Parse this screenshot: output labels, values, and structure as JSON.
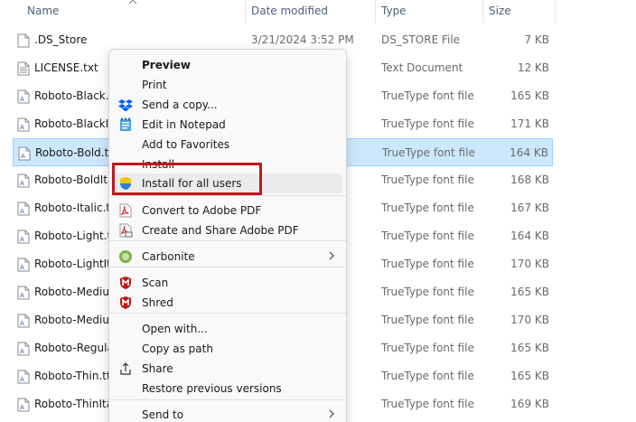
{
  "header": {
    "columns": [
      {
        "label": "Name"
      },
      {
        "label": "Date modified"
      },
      {
        "label": "Type"
      },
      {
        "label": "Size"
      }
    ]
  },
  "files": [
    {
      "name": ".DS_Store",
      "date": "3/21/2024 3:52 PM",
      "type": "DS_STORE File",
      "size": "7 KB",
      "icon": "generic-file-icon"
    },
    {
      "name": "LICENSE.txt",
      "date": "",
      "type": "Text Document",
      "size": "12 KB",
      "icon": "text-file-icon"
    },
    {
      "name": "Roboto-Black.ttf",
      "date": "",
      "type": "TrueType font file",
      "size": "165 KB",
      "icon": "font-file-icon"
    },
    {
      "name": "Roboto-BlackIta",
      "date": "",
      "type": "TrueType font file",
      "size": "171 KB",
      "icon": "font-file-icon"
    },
    {
      "name": "Roboto-Bold.ttf",
      "date": "",
      "type": "TrueType font file",
      "size": "164 KB",
      "icon": "font-file-icon",
      "selected": true
    },
    {
      "name": "Roboto-BoldIta",
      "date": "",
      "type": "TrueType font file",
      "size": "168 KB",
      "icon": "font-file-icon"
    },
    {
      "name": "Roboto-Italic.ttf",
      "date": "",
      "type": "TrueType font file",
      "size": "167 KB",
      "icon": "font-file-icon"
    },
    {
      "name": "Roboto-Light.ttf",
      "date": "",
      "type": "TrueType font file",
      "size": "164 KB",
      "icon": "font-file-icon"
    },
    {
      "name": "Roboto-LightIta",
      "date": "",
      "type": "TrueType font file",
      "size": "170 KB",
      "icon": "font-file-icon"
    },
    {
      "name": "Roboto-Mediur",
      "date": "",
      "type": "TrueType font file",
      "size": "165 KB",
      "icon": "font-file-icon"
    },
    {
      "name": "Roboto-Mediur",
      "date": "",
      "type": "TrueType font file",
      "size": "170 KB",
      "icon": "font-file-icon"
    },
    {
      "name": "Roboto-Regular",
      "date": "",
      "type": "TrueType font file",
      "size": "165 KB",
      "icon": "font-file-icon"
    },
    {
      "name": "Roboto-Thin.ttf",
      "date": "",
      "type": "TrueType font file",
      "size": "165 KB",
      "icon": "font-file-icon"
    },
    {
      "name": "Roboto-ThinItal",
      "date": "",
      "type": "TrueType font file",
      "size": "169 KB",
      "icon": "font-file-icon"
    }
  ],
  "context_menu": {
    "items": [
      {
        "label": "Preview",
        "bold": true,
        "icon": ""
      },
      {
        "label": "Print",
        "icon": ""
      },
      {
        "label": "Send a copy...",
        "icon": "dropbox-icon"
      },
      {
        "label": "Edit in Notepad",
        "icon": "notepad-icon"
      },
      {
        "label": "Add to Favorites",
        "icon": ""
      },
      {
        "label": "Install",
        "icon": ""
      },
      {
        "label": "Install for all users",
        "icon": "uac-shield-icon",
        "highlighted": true
      },
      {
        "label": "Convert to Adobe PDF",
        "icon": "adobe-pdf-icon"
      },
      {
        "label": "Create and Share Adobe PDF",
        "icon": "adobe-pdf-share-icon"
      },
      {
        "label": "Carbonite",
        "icon": "carbonite-icon",
        "submenu": true
      },
      {
        "label": "Scan",
        "icon": "mcafee-icon"
      },
      {
        "label": "Shred",
        "icon": "mcafee-icon"
      },
      {
        "label": "Open with...",
        "icon": ""
      },
      {
        "label": "Copy as path",
        "icon": ""
      },
      {
        "label": "Share",
        "icon": "share-icon"
      },
      {
        "label": "Restore previous versions",
        "icon": ""
      },
      {
        "label": "Send to",
        "icon": "",
        "submenu": true
      }
    ]
  },
  "colors": {
    "selection_bg": "#cce8ff",
    "highlight_box": "#c3151c",
    "header_text": "#4c607a"
  }
}
